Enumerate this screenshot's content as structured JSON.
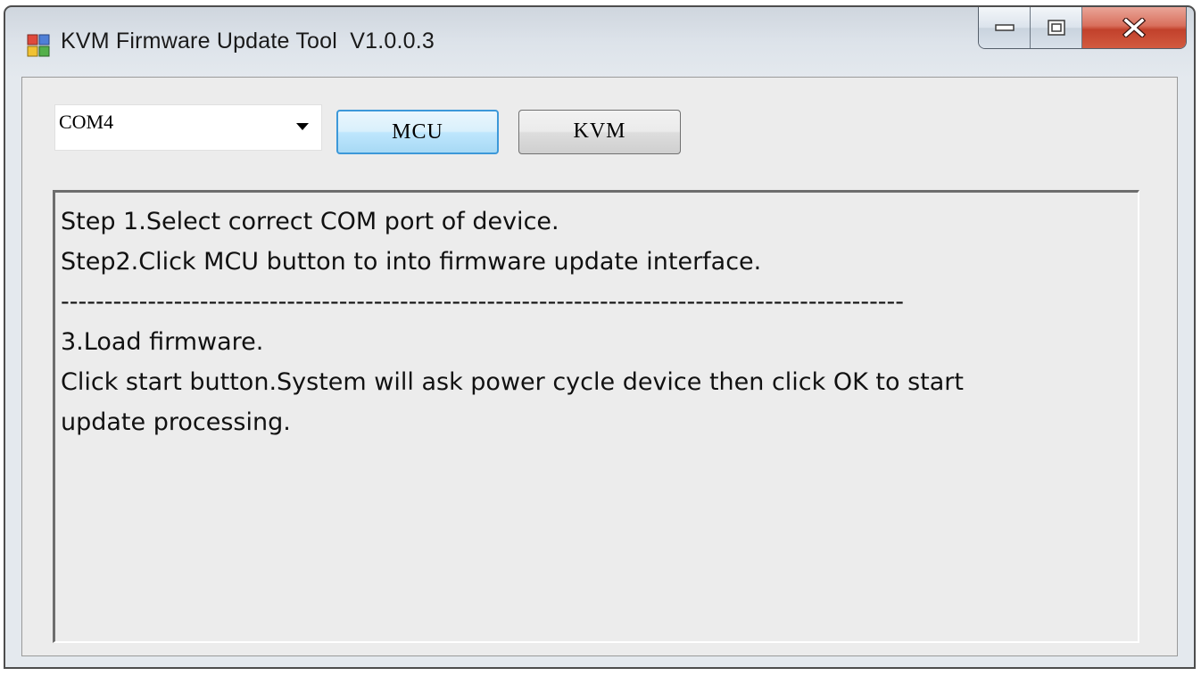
{
  "window": {
    "title": "KVM Firmware Update Tool  V1.0.0.3",
    "icons": {
      "app": "app-window-icon",
      "minimize": "minimize-icon",
      "maximize": "maximize-icon",
      "close": "close-icon"
    }
  },
  "toolbar": {
    "com_port": {
      "selected": "COM4"
    },
    "mcu_label": "MCU",
    "kvm_label": "KVM"
  },
  "log": {
    "lines": [
      "Step 1.Select correct COM port of device.",
      "Step2.Click MCU button to into firmware update interface.",
      "-------------------------------------------------------------------------------------------------",
      "3.Load firmware.",
      "Click start button.System will ask power cycle device then click OK to start",
      "update processing."
    ]
  },
  "colors": {
    "accent_button_border": "#3c98d9",
    "close_button": "#c2412c"
  }
}
